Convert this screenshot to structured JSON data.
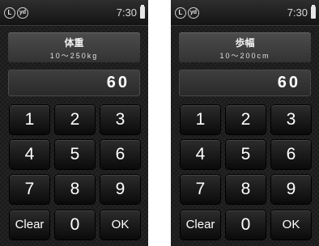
{
  "screens": [
    {
      "status": {
        "icon_l": "L",
        "icon_yd": "yd",
        "time": "7:30"
      },
      "title": "体重",
      "range": "10〜250kg",
      "value": "60",
      "keys": [
        "1",
        "2",
        "3",
        "4",
        "5",
        "6",
        "7",
        "8",
        "9",
        "Clear",
        "0",
        "OK"
      ]
    },
    {
      "status": {
        "icon_l": "L",
        "icon_yd": "yd",
        "time": "7:30"
      },
      "title": "歩幅",
      "range": "10〜200cm",
      "value": "60",
      "keys": [
        "1",
        "2",
        "3",
        "4",
        "5",
        "6",
        "7",
        "8",
        "9",
        "Clear",
        "0",
        "OK"
      ]
    }
  ]
}
